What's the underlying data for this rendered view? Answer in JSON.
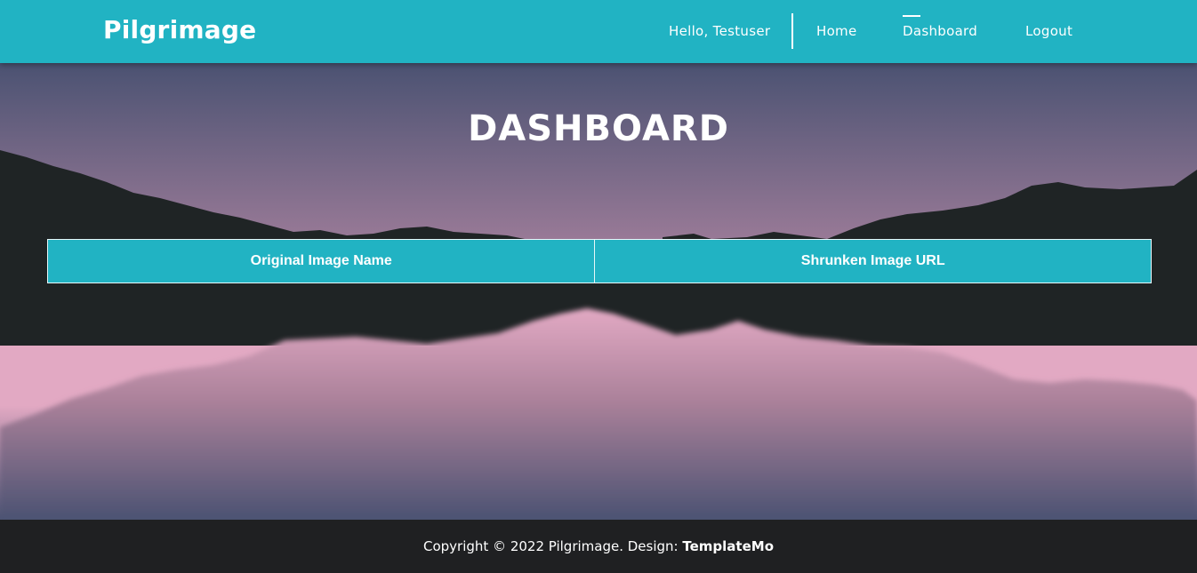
{
  "header": {
    "brand": "Pilgrimage",
    "greeting": "Hello, Testuser",
    "nav": {
      "home": "Home",
      "dashboard": "Dashboard",
      "logout": "Logout"
    },
    "active_item": "Dashboard"
  },
  "main": {
    "title": "DASHBOARD",
    "table": {
      "columns": [
        "Original Image Name",
        "Shrunken Image URL"
      ],
      "rows": []
    }
  },
  "footer": {
    "copyright_prefix": "Copyright © 2022 Pilgrimage. Design: ",
    "design_link": "TemplateMo"
  },
  "colors": {
    "accent": "#21b3c3",
    "footer_bg": "#1f2022",
    "sky_top": "#4b5272",
    "sky_bottom": "#e2a9c3",
    "mountain": "#1f2425"
  }
}
